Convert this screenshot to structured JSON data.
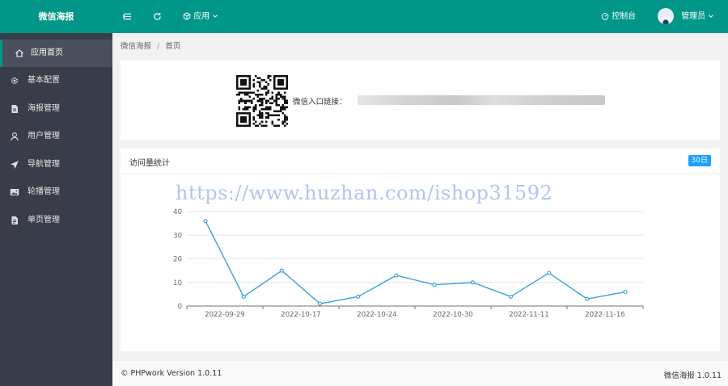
{
  "topbar": {
    "brand": "微信海报",
    "app_menu_label": "应用",
    "console_label": "控制台",
    "user_label": "管理员"
  },
  "sidebar": {
    "items": [
      {
        "label": "应用首页",
        "icon": "home-icon",
        "active": true
      },
      {
        "label": "基本配置",
        "icon": "gear-icon"
      },
      {
        "label": "海报管理",
        "icon": "file-icon"
      },
      {
        "label": "用户管理",
        "icon": "user-icon"
      },
      {
        "label": "导航管理",
        "icon": "navigation-icon"
      },
      {
        "label": "轮播管理",
        "icon": "image-icon"
      },
      {
        "label": "单页管理",
        "icon": "page-icon"
      }
    ]
  },
  "breadcrumb": [
    "微信海报",
    "首页"
  ],
  "qr_card": {
    "link_label": "微信入口链接："
  },
  "stats": {
    "title": "访问量统计",
    "badge": "30日"
  },
  "watermark": "https://www.huzhan.com/ishop31592",
  "chart_data": {
    "type": "line",
    "title": "",
    "x_ticks": [
      "2022-09-29",
      "2022-10-17",
      "2022-10-24",
      "2022-10-30",
      "2022-11-11",
      "2022-11-16"
    ],
    "y_ticks": [
      0,
      10,
      20,
      30,
      40
    ],
    "ylim": [
      0,
      40
    ],
    "values": [
      36,
      4,
      15,
      1,
      4,
      13,
      9,
      10,
      4,
      14,
      3,
      6
    ],
    "color": "#3ba3d8"
  },
  "footer": {
    "left": "© PHPwork Version 1.0.11",
    "right": "微信海报 1.0.11"
  }
}
